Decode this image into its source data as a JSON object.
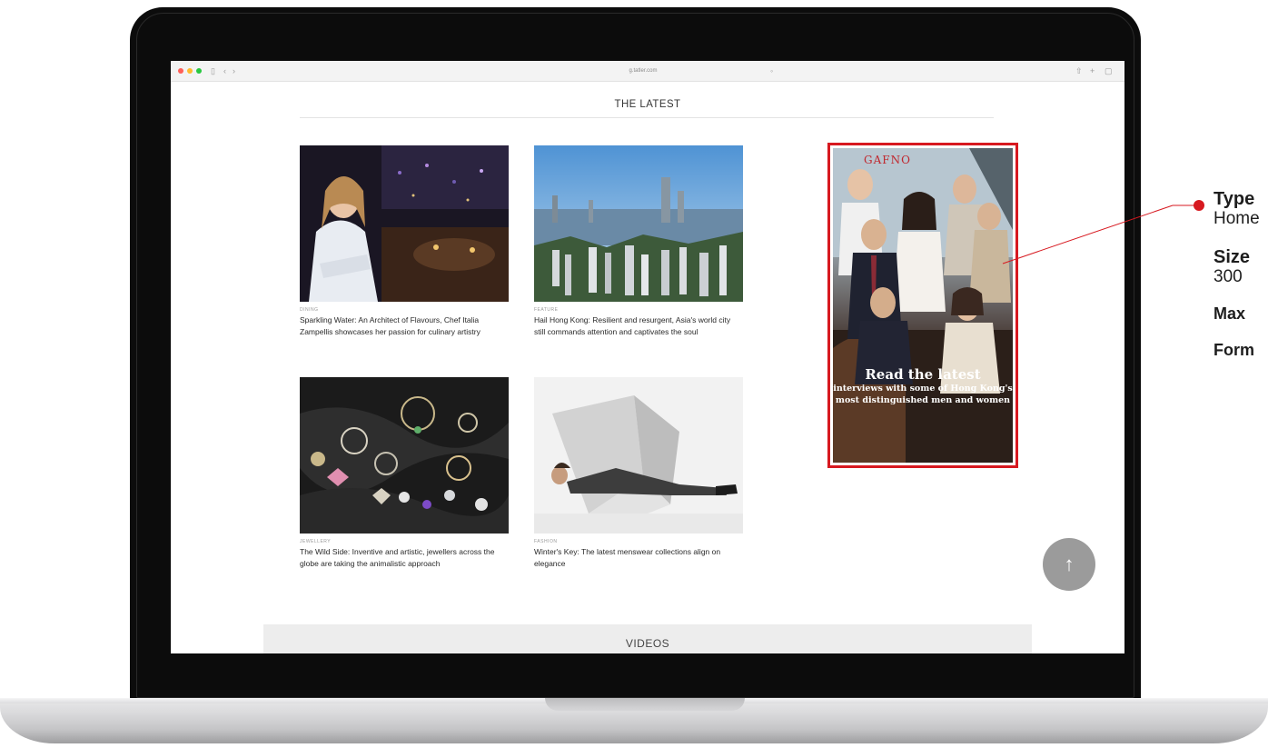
{
  "browser": {
    "url": "g.tatler.com"
  },
  "page": {
    "section_heading": "THE LATEST",
    "articles": [
      {
        "category": "DINING",
        "title": "Sparkling Water: An Architect of Flavours, Chef Italia Zampellis showcases her passion for culinary artistry"
      },
      {
        "category": "FEATURE",
        "title": "Hail Hong Kong: Resilient and resurgent, Asia's world city still commands attention and captivates the soul"
      },
      {
        "category": "JEWELLERY",
        "title": "The Wild Side: Inventive and artistic, jewellers across the globe are taking the animalistic approach"
      },
      {
        "category": "FASHION",
        "title": "Winter's Key: The latest menswear collections align on elegance"
      }
    ],
    "ad": {
      "masthead": "GAFNO",
      "headline": "Read the latest",
      "subline": "interviews with some of Hong Kong's most distinguished men and women"
    },
    "back_to_top": "↑",
    "videos_heading": "VIDEOS"
  },
  "callout": {
    "type_label": "Type",
    "type_value": "Home",
    "size_label": "Size",
    "size_value": "300",
    "max_label": "Max",
    "format_label": "Form"
  },
  "colors": {
    "accent": "#d71920",
    "laptop_bezel": "#0c0c0c"
  }
}
